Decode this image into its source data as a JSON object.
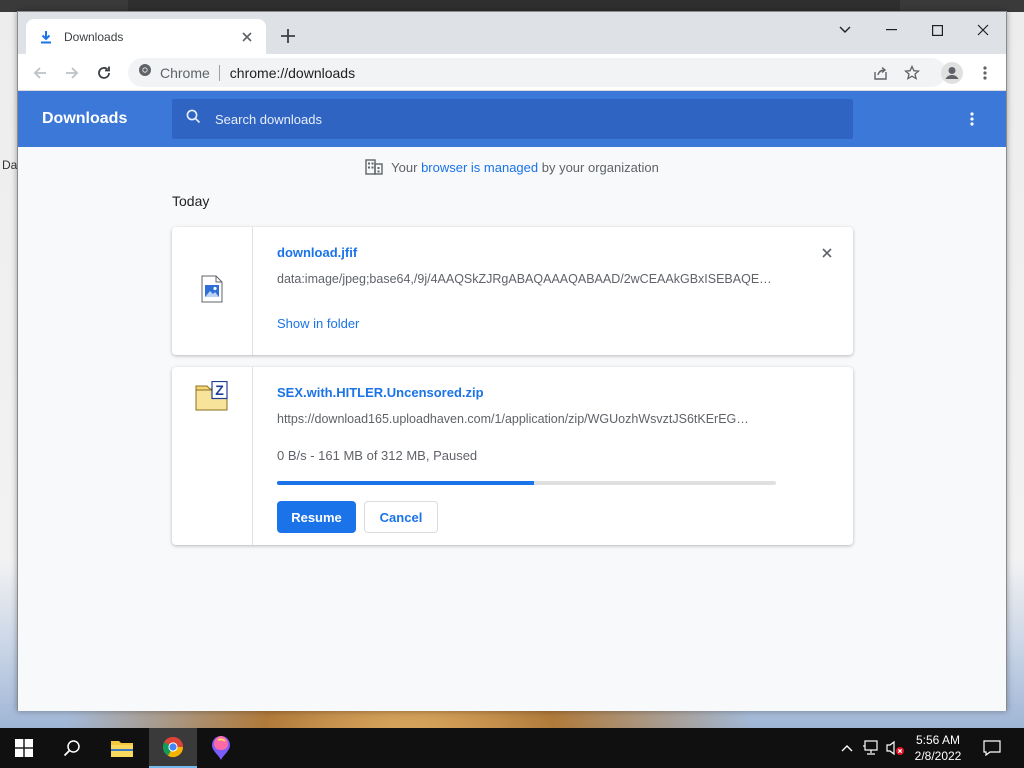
{
  "browser": {
    "tab_title": "Downloads",
    "omnibox": {
      "site_label": "Chrome",
      "url": "chrome://downloads"
    }
  },
  "downloads_page": {
    "title": "Downloads",
    "search_placeholder": "Search downloads",
    "managed_notice": {
      "prefix": "Your ",
      "link": "browser is managed",
      "suffix": " by your organization"
    },
    "section_title": "Today",
    "items": [
      {
        "file_name": "download.jfif",
        "url": "data:image/jpeg;base64,/9j/4AAQSkZJRgABAQAAAQABAAD/2wCEAAkGBxISEBAQE…",
        "show_in_folder": "Show in folder",
        "icon": "image-file-icon"
      },
      {
        "file_name": "SEX.with.HITLER.Uncensored.zip",
        "url": "https://download165.uploadhaven.com/1/application/zip/WGUozhWsvztJS6tKErEG…",
        "status": "0 B/s - 161 MB of 312 MB, Paused",
        "progress_fraction": 0.516,
        "resume_label": "Resume",
        "cancel_label": "Cancel",
        "icon": "zip-folder-icon"
      }
    ]
  },
  "taskbar": {
    "time": "5:56 AM",
    "date": "2/8/2022"
  },
  "colors": {
    "header_blue": "#3c78d8",
    "accent_blue": "#1a73e8",
    "page_bg": "#f8f9fa"
  },
  "background": {
    "left_edge_text": "Da"
  }
}
